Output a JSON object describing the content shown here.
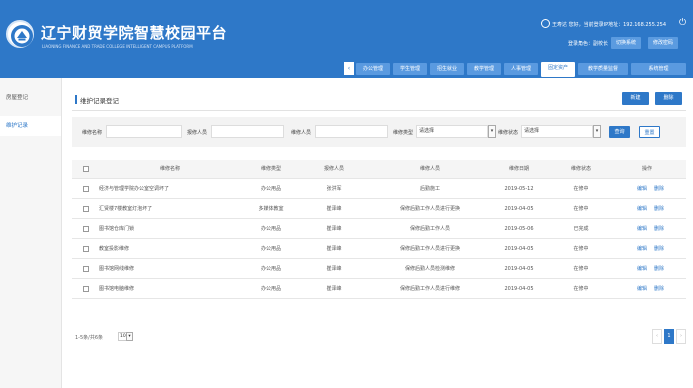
{
  "header": {
    "title": "辽宁财贸学院智慧校园平台",
    "subtitle": "LIAONING FINANCE AND TRADE COLLEGE INTELLIGENT CAMPUS PLATFORM",
    "user_info": "王寿达 您好，当前登录IP地址：192.168.255.254",
    "role": "登录角色：副校长",
    "buttons": [
      "切换系统",
      "修改密码"
    ],
    "tabs": [
      "办公管理",
      "学生管理",
      "招生就业",
      "教学管理",
      "人事管理",
      "固定资产",
      "教学质量监督",
      "系统管理"
    ],
    "active_tab": "固定资产"
  },
  "sidebar": {
    "items": [
      "房屋登记",
      "维护记录"
    ],
    "active": "维护记录"
  },
  "page": {
    "breadcrumb": "维护记录登记",
    "add_label": "新建",
    "delete_label": "删除"
  },
  "filters": {
    "name_label": "维修名称",
    "reporter_label": "报修人员",
    "repairer_label": "维修人员",
    "type_label": "维修类型",
    "type_value": "请选择",
    "status_label": "维修状态",
    "status_value": "请选择",
    "query_label": "查询",
    "reset_label": "重置"
  },
  "table": {
    "columns": [
      "维修名称",
      "维修类型",
      "报修人员",
      "维修人员",
      "维修日期",
      "维修状态",
      "操作"
    ],
    "rows": [
      {
        "name": "经济与管理学院办公室空调坏了",
        "type": "办公用品",
        "reporter": "张洪军",
        "repairer": "后勤施工",
        "date": "2019-05-12",
        "status": "在修中"
      },
      {
        "name": "汇贤楼7楼教室灯泡坏了",
        "type": "多媒体教室",
        "reporter": "崔泽峰",
        "repairer": "保修后勤工作人员进行更换",
        "date": "2019-04-05",
        "status": "在修中"
      },
      {
        "name": "图书馆仓库门锁",
        "type": "办公用品",
        "reporter": "崔泽峰",
        "repairer": "保修后勤工作人员",
        "date": "2019-05-06",
        "status": "已完成"
      },
      {
        "name": "教室投影维修",
        "type": "办公用品",
        "reporter": "崔泽峰",
        "repairer": "保修后勤工作人员进行更换",
        "date": "2019-04-05",
        "status": "在修中"
      },
      {
        "name": "图书馆网线维修",
        "type": "办公用品",
        "reporter": "崔泽峰",
        "repairer": "保修后勤人员检测维修",
        "date": "2019-04-05",
        "status": "在修中"
      },
      {
        "name": "图书馆电脑维修",
        "type": "办公用品",
        "reporter": "崔泽峰",
        "repairer": "保修后勤工作人员进行维修",
        "date": "2019-04-05",
        "status": "在修中"
      }
    ],
    "edit_label": "编辑",
    "delete_label": "删除"
  },
  "pager": {
    "info": "1-5条/共6条",
    "page_size": "10",
    "current_page": "1"
  },
  "colors": {
    "brand": "#2e78c8",
    "tab": "#5a9ae0"
  }
}
